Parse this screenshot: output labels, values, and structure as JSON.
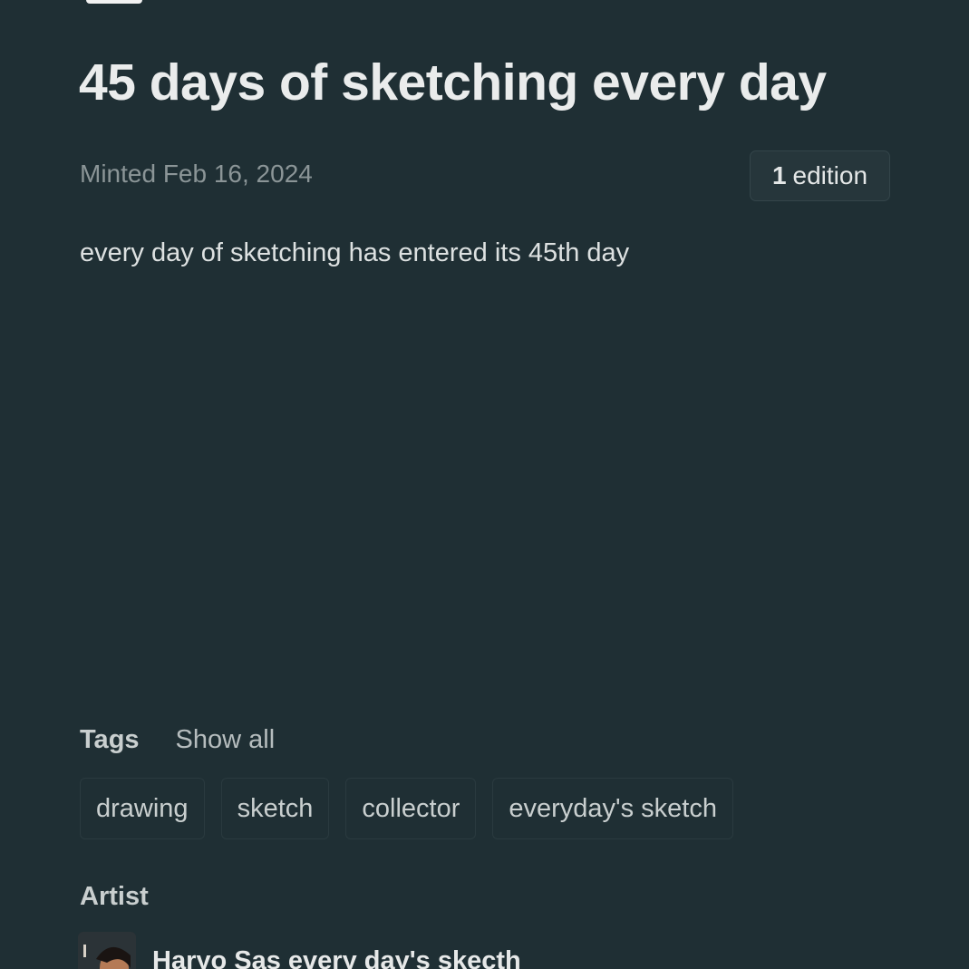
{
  "nft": {
    "title": "45 days of sketching every day",
    "minted_date": "Minted Feb 16, 2024",
    "edition_count": "1",
    "edition_label": "edition",
    "description": "every day of sketching has entered its 45th day"
  },
  "tags": {
    "label": "Tags",
    "show_all": "Show all",
    "items": [
      "drawing",
      "sketch",
      "collector",
      "everyday's sketch"
    ]
  },
  "artist": {
    "label": "Artist",
    "name": "Haryo Sas every day's skecth"
  },
  "colors": {
    "background": "#1f2f34",
    "badge_background": "#26363b",
    "muted_text": "#8b9597"
  }
}
